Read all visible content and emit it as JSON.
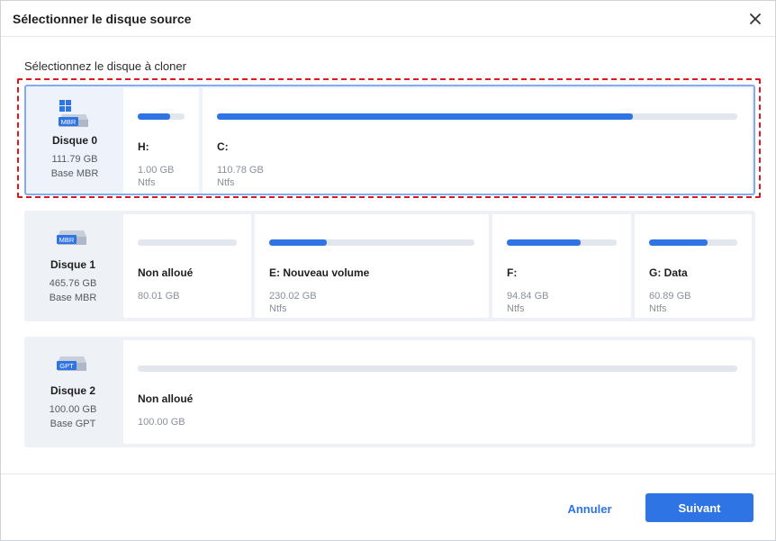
{
  "dialog": {
    "title": "Sélectionner le disque source",
    "subtitle": "Sélectionnez le disque à cloner"
  },
  "colors": {
    "accent": "#2f74e4",
    "selection_marker": "#e0151d"
  },
  "disks": [
    {
      "name": "Disque 0",
      "size": "111.79 GB",
      "type": "Base MBR",
      "badge": "MBR",
      "icon": "windows-system-disk-icon",
      "selected": true,
      "partitions": [
        {
          "label": "H:",
          "size": "1.00 GB",
          "fs": "Ntfs",
          "used_fraction": 0.7
        },
        {
          "label": "C:",
          "size": "110.78 GB",
          "fs": "Ntfs",
          "used_fraction": 0.8
        }
      ]
    },
    {
      "name": "Disque 1",
      "size": "465.76 GB",
      "type": "Base MBR",
      "badge": "MBR",
      "icon": "hard-disk-icon",
      "selected": false,
      "partitions": [
        {
          "label": "Non alloué",
          "size": "80.01 GB",
          "fs": "",
          "used_fraction": 0.0
        },
        {
          "label": "E: Nouveau volume",
          "size": "230.02 GB",
          "fs": "Ntfs",
          "used_fraction": 0.28
        },
        {
          "label": "F:",
          "size": "94.84 GB",
          "fs": "Ntfs",
          "used_fraction": 0.67
        },
        {
          "label": "G: Data",
          "size": "60.89 GB",
          "fs": "Ntfs",
          "used_fraction": 0.66
        }
      ]
    },
    {
      "name": "Disque 2",
      "size": "100.00 GB",
      "type": "Base GPT",
      "badge": "GPT",
      "icon": "hard-disk-icon",
      "selected": false,
      "partitions": [
        {
          "label": "Non alloué",
          "size": "100.00 GB",
          "fs": "",
          "used_fraction": 0.0
        }
      ]
    }
  ],
  "footer": {
    "cancel_label": "Annuler",
    "next_label": "Suivant"
  }
}
